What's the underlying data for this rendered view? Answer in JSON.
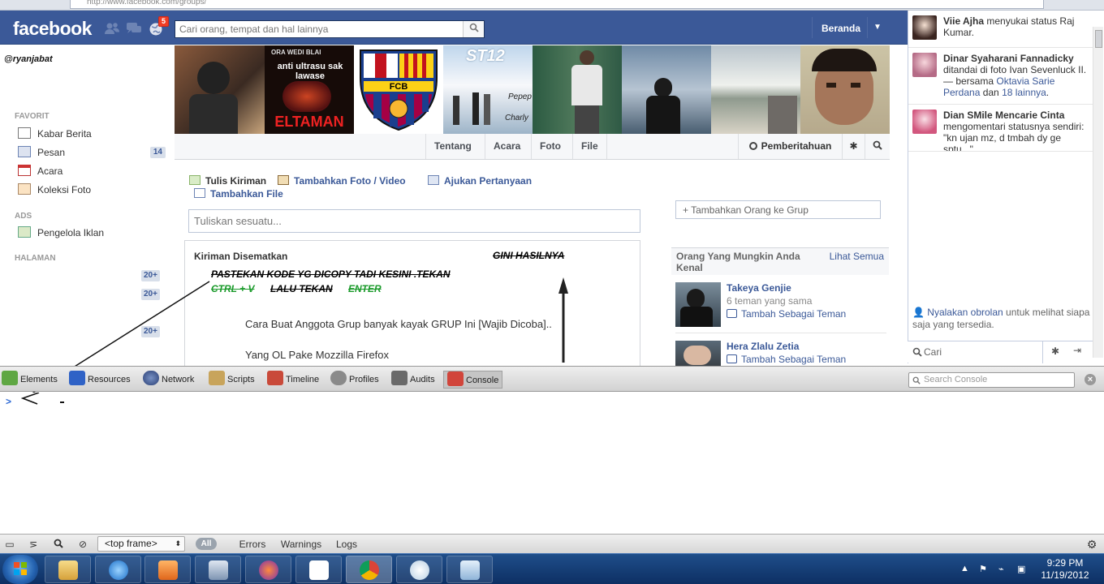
{
  "browser": {
    "url": "http://www.facebook.com/groups/"
  },
  "header": {
    "logo": "facebook",
    "notif_count": "5",
    "search_placeholder": "Cari orang, tempat dan hal lainnya",
    "home": "Beranda"
  },
  "leftnav": {
    "username": "@ryanjabat",
    "fav_header": "FAVORIT",
    "items": [
      {
        "label": "Kabar Berita",
        "count": ""
      },
      {
        "label": "Pesan",
        "count": "14"
      },
      {
        "label": "Acara",
        "count": ""
      },
      {
        "label": "Koleksi Foto",
        "count": ""
      }
    ],
    "ads_header": "ADS",
    "ads_item": "Pengelola Iklan",
    "pages_header": "HALAMAN",
    "page_counts": [
      "20+",
      "20+",
      "20+"
    ]
  },
  "cover": {
    "text_a": "ORA WEDI BLAI",
    "text_b": "anti ultrasu sak lawase",
    "text_c": "ELTAMAN",
    "crest": "FCB",
    "st": "ST12",
    "pepep": "Pepep",
    "charly": "Charly"
  },
  "group_tabs": {
    "tabs": [
      "Tentang",
      "Acara",
      "Foto",
      "File"
    ],
    "notifications": "Pemberitahuan"
  },
  "composer": {
    "post": "Tulis Kiriman",
    "photo": "Tambahkan Foto / Video",
    "question": "Ajukan Pertanyaan",
    "file": "Tambahkan File",
    "placeholder": "Tuliskan sesuatu..."
  },
  "pinned": {
    "title": "Kiriman Disematkan",
    "line1": "Cara Buat Anggota Grup banyak kayak GRUP Ini [Wajib Dicoba]..",
    "line2": "Yang OL Pake Mozzilla Firefox"
  },
  "annotations": {
    "hasil": "GINI HASILNYA",
    "instr1": "PASTEKAN KODE YG DICOPY TADI KESINI .TEKAN",
    "ctrl": "CTRL + V",
    "lalu": "LALU TEKAN",
    "enter": "ENTER"
  },
  "right": {
    "add_people": "+ Tambahkan Orang ke Grup",
    "suggest_title": "Orang Yang Mungkin Anda Kenal",
    "see_all": "Lihat Semua",
    "suggestions": [
      {
        "name": "Takeya Genjie",
        "mutual": "6 teman yang sama",
        "add": "Tambah Sebagai Teman"
      },
      {
        "name": "Hera Zlalu Zetia",
        "mutual": "",
        "add": "Tambah Sebagai Teman"
      }
    ]
  },
  "ticker": {
    "items": [
      {
        "name": "Viie Ajha",
        "text": " menyukai status Raj Kumar."
      },
      {
        "name": "Dinar Syaharani Fannadicky",
        "text": " ditandai di foto Ivan Sevenluck II. — bersama ",
        "link1": "Oktavia Sarie Perdana",
        "mid": " dan ",
        "link2": "18 lainnya",
        "end": "."
      },
      {
        "name": "Dian SMile Mencarie Cinta",
        "text": " mengomentari statusnya sendiri: \"kn ujan mz, d tmbah dy ge sptu...\""
      }
    ],
    "chat_link": "Nyalakan obrolan",
    "chat_text": " untuk melihat siapa saja yang tersedia.",
    "chat_search": "Cari"
  },
  "devtools": {
    "tabs": [
      "Elements",
      "Resources",
      "Network",
      "Scripts",
      "Timeline",
      "Profiles",
      "Audits",
      "Console"
    ],
    "search_placeholder": "Search Console",
    "prompt": ">",
    "frame": "<top frame>",
    "all": "All",
    "filters": [
      "Errors",
      "Warnings",
      "Logs"
    ]
  },
  "taskbar": {
    "time": "9:29 PM",
    "date": "11/19/2012"
  }
}
